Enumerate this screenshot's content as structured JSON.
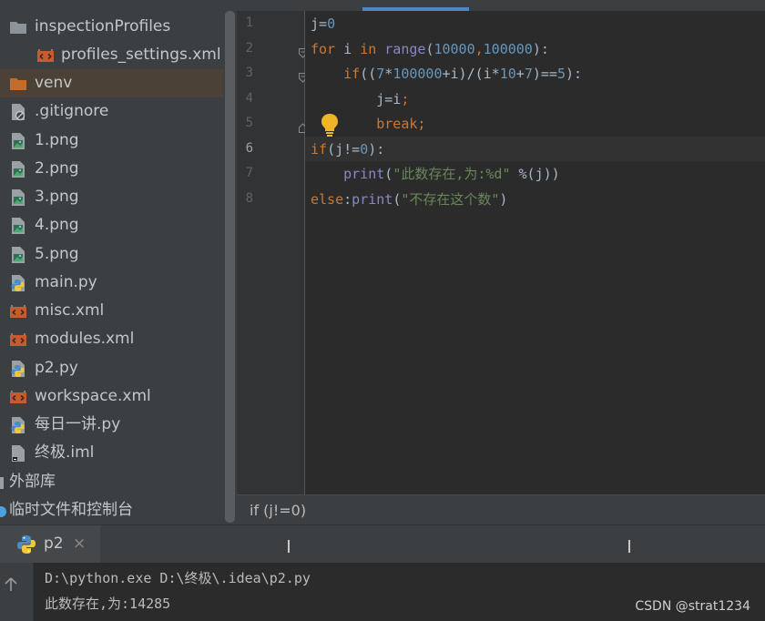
{
  "project_tree": {
    "items": [
      {
        "label": "inspectionProfiles",
        "icon": "folder-icon"
      },
      {
        "label": "profiles_settings.xml",
        "icon": "xml-file-icon"
      },
      {
        "label": "venv",
        "icon": "folder-excluded-icon"
      },
      {
        "label": ".gitignore",
        "icon": "ignored-file-icon"
      },
      {
        "label": "1.png",
        "icon": "image-file-icon"
      },
      {
        "label": "2.png",
        "icon": "image-file-icon"
      },
      {
        "label": "3.png",
        "icon": "image-file-icon"
      },
      {
        "label": "4.png",
        "icon": "image-file-icon"
      },
      {
        "label": "5.png",
        "icon": "image-file-icon"
      },
      {
        "label": "main.py",
        "icon": "python-file-icon"
      },
      {
        "label": "misc.xml",
        "icon": "xml-file-icon"
      },
      {
        "label": "modules.xml",
        "icon": "xml-file-icon"
      },
      {
        "label": "p2.py",
        "icon": "python-file-icon"
      },
      {
        "label": "workspace.xml",
        "icon": "xml-file-icon"
      },
      {
        "label": "每日一讲.py",
        "icon": "python-file-icon"
      },
      {
        "label": "终极.iml",
        "icon": "module-file-icon"
      },
      {
        "label": "外部库",
        "icon": "external-libraries-icon"
      },
      {
        "label": "临时文件和控制台",
        "icon": "scratches-icon"
      }
    ]
  },
  "editor": {
    "line_numbers": [
      "1",
      "2",
      "3",
      "4",
      "5",
      "6",
      "7",
      "8"
    ],
    "current_line": "6",
    "lines": [
      [
        {
          "t": "j=",
          "c": ""
        },
        {
          "t": "0",
          "c": "num"
        }
      ],
      [
        {
          "t": "for",
          "c": "kw"
        },
        {
          "t": " i ",
          "c": ""
        },
        {
          "t": "in",
          "c": "kw"
        },
        {
          "t": " ",
          "c": ""
        },
        {
          "t": "range",
          "c": "bi"
        },
        {
          "t": "(",
          "c": ""
        },
        {
          "t": "10000",
          "c": "num"
        },
        {
          "t": ",",
          "c": "kw"
        },
        {
          "t": "100000",
          "c": "num"
        },
        {
          "t": "):",
          "c": ""
        }
      ],
      [
        {
          "t": "    ",
          "c": ""
        },
        {
          "t": "if",
          "c": "kw"
        },
        {
          "t": "((",
          "c": ""
        },
        {
          "t": "7",
          "c": "num"
        },
        {
          "t": "*",
          "c": ""
        },
        {
          "t": "100000",
          "c": "num"
        },
        {
          "t": "+i)/(i*",
          "c": ""
        },
        {
          "t": "10",
          "c": "num"
        },
        {
          "t": "+",
          "c": ""
        },
        {
          "t": "7",
          "c": "num"
        },
        {
          "t": ")==",
          "c": ""
        },
        {
          "t": "5",
          "c": "num"
        },
        {
          "t": "):",
          "c": ""
        }
      ],
      [
        {
          "t": "        j=i",
          "c": ""
        },
        {
          "t": ";",
          "c": "kw"
        }
      ],
      [
        {
          "t": "        ",
          "c": ""
        },
        {
          "t": "break",
          "c": "kw"
        },
        {
          "t": ";",
          "c": "kw"
        }
      ],
      [
        {
          "t": "if",
          "c": "kw"
        },
        {
          "t": "(j!=",
          "c": ""
        },
        {
          "t": "0",
          "c": "num"
        },
        {
          "t": "):",
          "c": ""
        }
      ],
      [
        {
          "t": "    ",
          "c": ""
        },
        {
          "t": "print",
          "c": "bi"
        },
        {
          "t": "(",
          "c": ""
        },
        {
          "t": "\"此数存在,为:%d\"",
          "c": "str"
        },
        {
          "t": " %(j))",
          "c": ""
        }
      ],
      [
        {
          "t": "else",
          "c": "kw"
        },
        {
          "t": ":",
          "c": ""
        },
        {
          "t": "print",
          "c": "bi"
        },
        {
          "t": "(",
          "c": ""
        },
        {
          "t": "\"不存在这个数\"",
          "c": "str"
        },
        {
          "t": ")",
          "c": ""
        }
      ]
    ]
  },
  "breadcrumb": {
    "text": "if (j!=0)"
  },
  "run": {
    "tab_label": "p2",
    "close_glyph": "×",
    "console": [
      "D:\\python.exe D:\\终极\\.idea\\p2.py",
      "此数存在,为:14285"
    ]
  },
  "watermark": "CSDN @strat1234",
  "colors": {
    "keyword": "#cc7832",
    "number": "#6897bb",
    "string": "#6a8759",
    "builtin": "#8888c6",
    "xml_icon": "#c75a2e",
    "folder_icon": "#8c9399",
    "excluded_folder": "#c56c2a",
    "accent": "#4a88c7"
  }
}
